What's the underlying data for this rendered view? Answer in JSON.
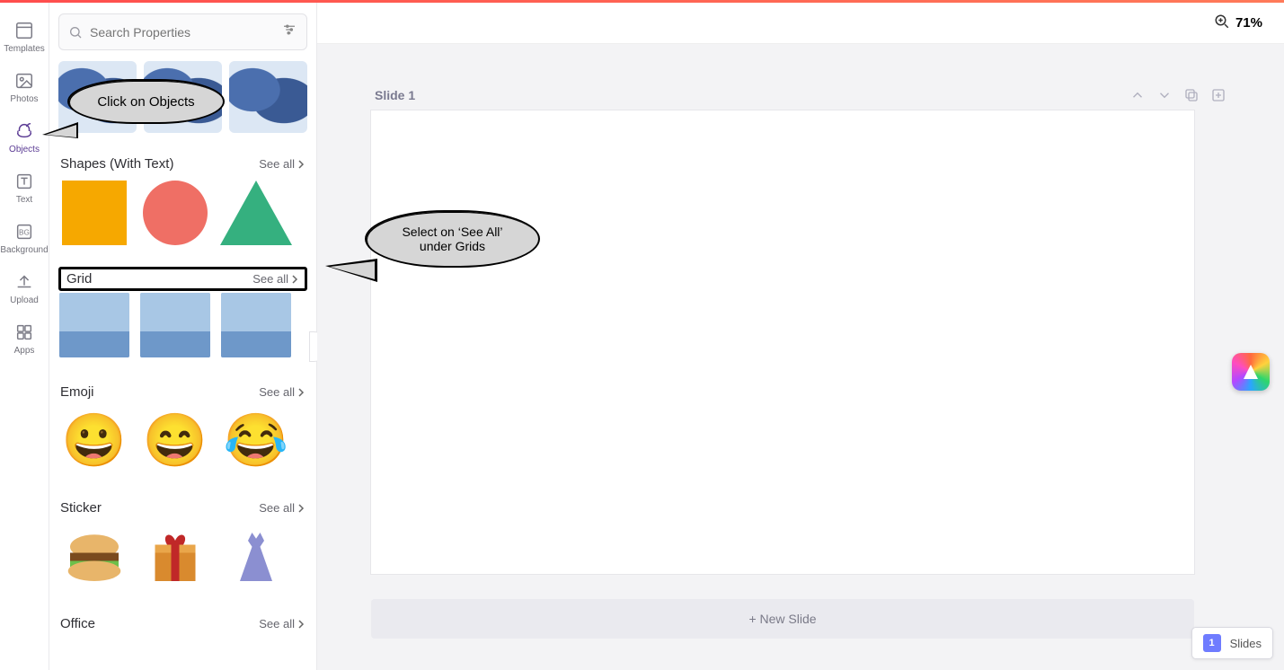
{
  "zoom": {
    "label": "71%"
  },
  "search": {
    "placeholder": "Search Properties"
  },
  "rail": {
    "items": [
      {
        "label": "Templates"
      },
      {
        "label": "Photos"
      },
      {
        "label": "Objects"
      },
      {
        "label": "Text"
      },
      {
        "label": "Background"
      },
      {
        "label": "Upload"
      },
      {
        "label": "Apps"
      }
    ]
  },
  "categories": {
    "shapes": {
      "title": "Shapes (With Text)",
      "see_all": "See all"
    },
    "grid": {
      "title": "Grid",
      "see_all": "See all"
    },
    "emoji": {
      "title": "Emoji",
      "see_all": "See all"
    },
    "sticker": {
      "title": "Sticker",
      "see_all": "See all"
    },
    "office": {
      "title": "Office",
      "see_all": "See all"
    }
  },
  "emoji_items": [
    "😀",
    "😄",
    "😂"
  ],
  "slide": {
    "title": "Slide 1",
    "new_slide": "+ New Slide"
  },
  "slides_panel": {
    "count": "1",
    "label": "Slides"
  },
  "callouts": {
    "objects": "Click on Objects",
    "grid_seeall": "Select on ‘See All’\nunder Grids"
  }
}
